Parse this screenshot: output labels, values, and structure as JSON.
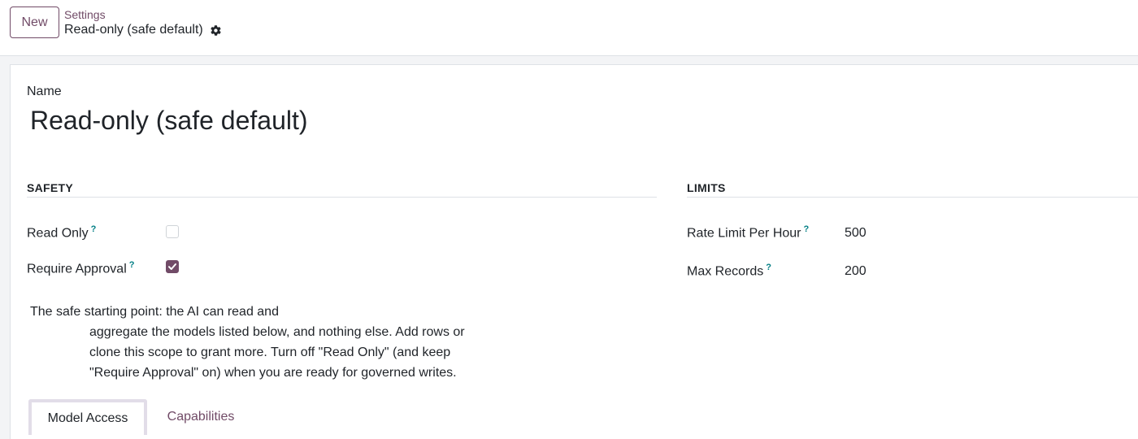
{
  "control_panel": {
    "new_button": "New",
    "breadcrumb_parent": "Settings",
    "breadcrumb_current": "Read-only (safe default)",
    "gear_icon": "gear-icon"
  },
  "form": {
    "name_label": "Name",
    "name_value": "Read-only (safe default)",
    "safety": {
      "title": "SAFETY",
      "read_only_label": "Read Only",
      "read_only_checked": false,
      "require_approval_label": "Require Approval",
      "require_approval_checked": true,
      "tooltip_marker": "?"
    },
    "limits": {
      "title": "LIMITS",
      "rate_limit_label": "Rate Limit Per Hour",
      "rate_limit_value": "500",
      "max_records_label": "Max Records",
      "max_records_value": "200",
      "tooltip_marker": "?"
    },
    "help_lines": [
      "The safe starting point: the AI can read and",
      "aggregate the models listed below, and nothing else. Add rows or",
      "clone this scope to grant more. Turn off \"Read Only\" (and keep",
      "\"Require Approval\" on) when you are ready for governed writes."
    ],
    "tabs": [
      {
        "label": "Model Access",
        "active": true
      },
      {
        "label": "Capabilities",
        "active": false
      }
    ]
  },
  "colors": {
    "accent": "#714b67",
    "tooltip": "#017e84",
    "border": "#dee2e6"
  }
}
